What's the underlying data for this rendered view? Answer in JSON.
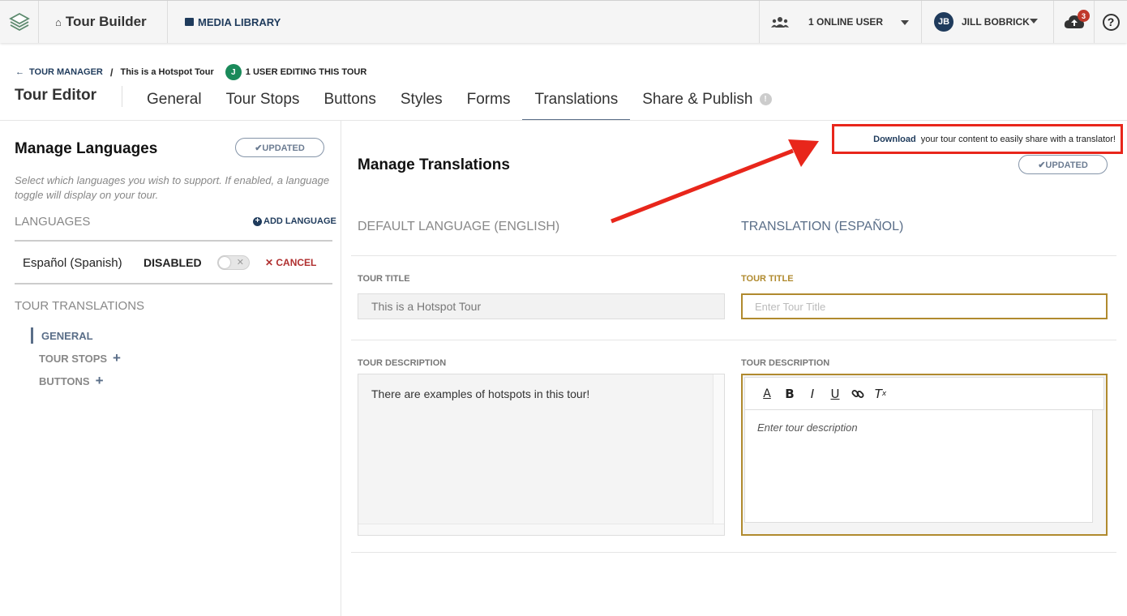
{
  "topbar": {
    "app_name": "Tour Builder",
    "media_library": "MEDIA LIBRARY",
    "online_users": "1 ONLINE USER",
    "user_initials": "JB",
    "user_name": "JILL BOBRICK",
    "notification_count": "3",
    "help_glyph": "?"
  },
  "breadcrumb": {
    "back_link": "TOUR MANAGER",
    "separator": "/",
    "current": "This is a Hotspot Tour",
    "editor_initial": "J",
    "editing_status": "1 USER EDITING THIS TOUR"
  },
  "editor": {
    "title": "Tour Editor",
    "tabs": [
      {
        "label": "General"
      },
      {
        "label": "Tour Stops"
      },
      {
        "label": "Buttons"
      },
      {
        "label": "Styles"
      },
      {
        "label": "Forms"
      },
      {
        "label": "Translations",
        "active": true
      },
      {
        "label": "Share & Publish",
        "alert": "!"
      }
    ]
  },
  "left_panel": {
    "title": "Manage Languages",
    "updated_label": "✔UPDATED",
    "help_text": "Select which languages you wish to support. If enabled, a language toggle will display on your tour.",
    "languages_heading": "LANGUAGES",
    "add_language": "ADD LANGUAGE",
    "language_row": {
      "name": "Español (Spanish)",
      "status": "DISABLED",
      "toggle_on": false,
      "cancel": "✕ CANCEL"
    },
    "translations_heading": "TOUR TRANSLATIONS",
    "nav_items": [
      {
        "label": "GENERAL",
        "active": true
      },
      {
        "label": "TOUR STOPS",
        "expand": "+"
      },
      {
        "label": "BUTTONS",
        "expand": "+"
      }
    ]
  },
  "right_panel": {
    "title": "Manage Translations",
    "updated_label": "✔UPDATED",
    "callout": {
      "download": "Download",
      "text": "your tour content to easily share with a translator!"
    },
    "default_heading": "DEFAULT LANGUAGE (ENGLISH)",
    "translation_heading": "TRANSLATION (ESPAÑOL)",
    "tour_title_label": "TOUR TITLE",
    "tour_title_value": "This is a Hotspot Tour",
    "tour_title_placeholder": "Enter Tour Title",
    "tour_description_label": "TOUR DESCRIPTION",
    "tour_description_value": "There are examples of hotspots in this tour!",
    "tour_description_placeholder": "Enter tour description",
    "toolbar_icons": [
      "font-color-icon",
      "bold-icon",
      "italic-icon",
      "underline-icon",
      "link-icon",
      "clear-format-icon"
    ]
  },
  "colors": {
    "accent_navy": "#1f3b5c",
    "gold": "#b08a2e",
    "callout_red": "#e8261b",
    "cancel_red": "#b03030"
  }
}
